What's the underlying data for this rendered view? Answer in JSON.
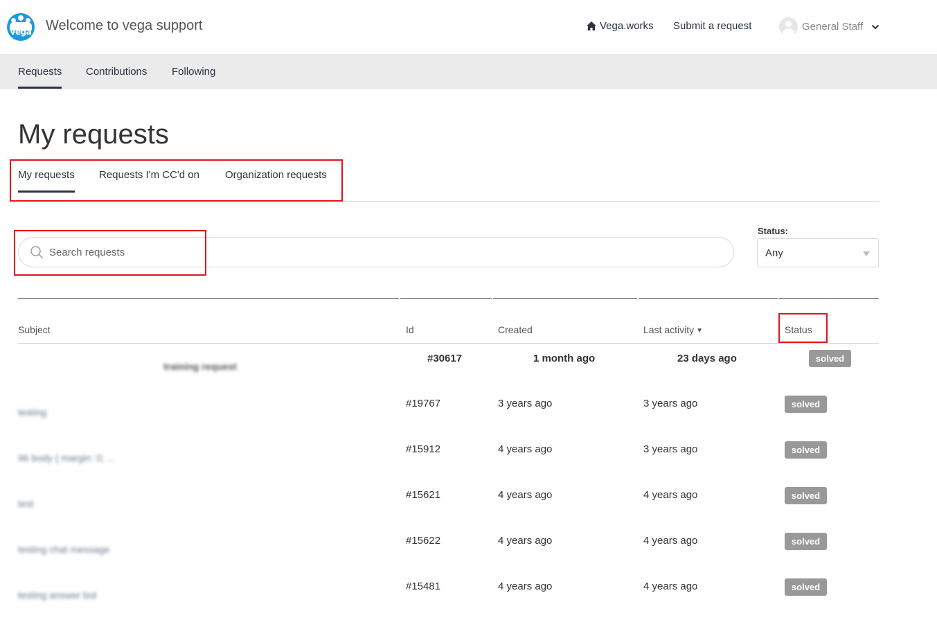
{
  "header": {
    "site_title": "Welcome to vega support",
    "logo_text": "vega",
    "nav_home": "Vega.works",
    "nav_submit": "Submit a request",
    "user_name": "General Staff"
  },
  "subnav": {
    "items": [
      {
        "label": "Requests",
        "active": true
      },
      {
        "label": "Contributions",
        "active": false
      },
      {
        "label": "Following",
        "active": false
      }
    ]
  },
  "page_title": "My requests",
  "tabs": [
    {
      "label": "My requests",
      "active": true
    },
    {
      "label": "Requests I'm CC'd on",
      "active": false
    },
    {
      "label": "Organization requests",
      "active": false
    }
  ],
  "search": {
    "placeholder": "Search requests",
    "value": ""
  },
  "status_filter": {
    "label": "Status:",
    "selected": "Any"
  },
  "table": {
    "columns": {
      "subject": "Subject",
      "id": "Id",
      "created": "Created",
      "last_activity": "Last activity",
      "status": "Status"
    },
    "sort_indicator": "▼",
    "rows": [
      {
        "subject": "training request",
        "id": "#30617",
        "created": "1 month ago",
        "last_activity": "23 days ago",
        "status": "solved"
      },
      {
        "subject": "testing",
        "id": "#19767",
        "created": "3 years ago",
        "last_activity": "3 years ago",
        "status": "solved"
      },
      {
        "subject": "96 body { margin: 0; ...",
        "id": "#15912",
        "created": "4 years ago",
        "last_activity": "3 years ago",
        "status": "solved"
      },
      {
        "subject": "test",
        "id": "#15621",
        "created": "4 years ago",
        "last_activity": "4 years ago",
        "status": "solved"
      },
      {
        "subject": "testing chat message",
        "id": "#15622",
        "created": "4 years ago",
        "last_activity": "4 years ago",
        "status": "solved"
      },
      {
        "subject": "testing answer bot",
        "id": "#15481",
        "created": "4 years ago",
        "last_activity": "4 years ago",
        "status": "solved"
      }
    ]
  }
}
